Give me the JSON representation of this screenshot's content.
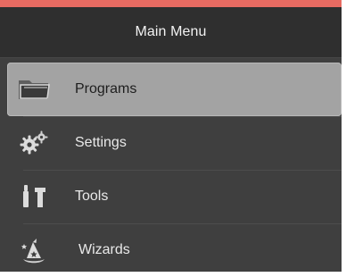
{
  "header": {
    "title": "Main Menu"
  },
  "menu": {
    "items": [
      {
        "label": "Programs",
        "icon": "folder-icon",
        "selected": true
      },
      {
        "label": "Settings",
        "icon": "gears-icon",
        "selected": false
      },
      {
        "label": "Tools",
        "icon": "tools-icon",
        "selected": false
      },
      {
        "label": "Wizards",
        "icon": "wizard-hat-icon",
        "selected": false
      }
    ]
  },
  "colors": {
    "accent_top_border": "#e86b62",
    "panel_bg": "#3f3f3f",
    "header_bg": "#2f2f2f",
    "selected_bg": "#a3a3a3",
    "text_light": "#e9e9e9",
    "text_dark": "#1e1e1e"
  }
}
